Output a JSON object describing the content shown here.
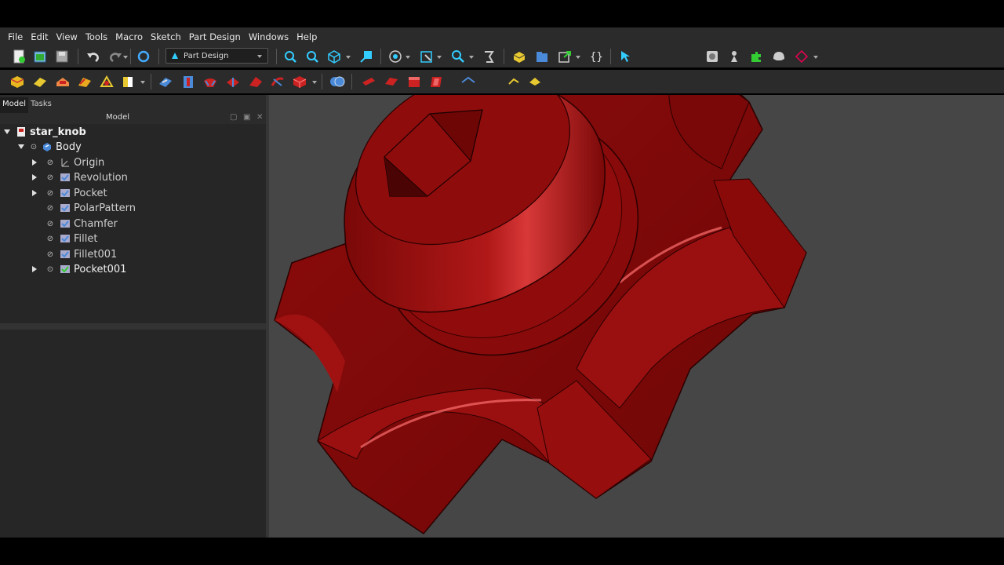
{
  "menu": [
    "File",
    "Edit",
    "View",
    "Tools",
    "Macro",
    "Sketch",
    "Part Design",
    "Windows",
    "Help"
  ],
  "workbench": {
    "selected": "Part Design"
  },
  "tabs": {
    "model": "Model",
    "tasks": "Tasks"
  },
  "panel_title": "Model",
  "tree": {
    "root": "star_knob",
    "body": "Body",
    "features": [
      "Origin",
      "Revolution",
      "Pocket",
      "PolarPattern",
      "Chamfer",
      "Fillet",
      "Fillet001",
      "Pocket001"
    ]
  },
  "colors": {
    "model_red": "#8b0a0a",
    "viewport_bg": "#464646",
    "panel_bg": "#2b2b2b"
  }
}
